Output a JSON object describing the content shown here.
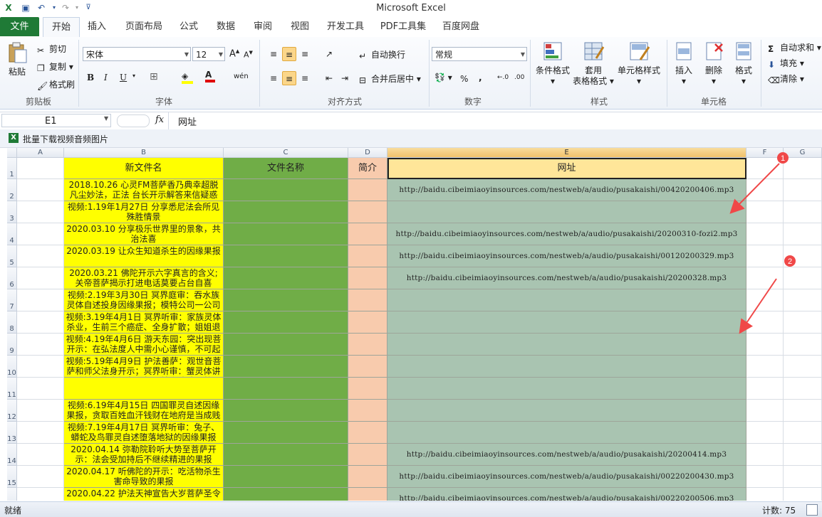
{
  "app": {
    "title": "Microsoft Excel"
  },
  "tabs": [
    "文件",
    "开始",
    "插入",
    "页面布局",
    "公式",
    "数据",
    "审阅",
    "视图",
    "开发工具",
    "PDF工具集",
    "百度网盘"
  ],
  "ribbon": {
    "clipboard": {
      "label": "剪贴板",
      "paste": "粘贴",
      "cut": "剪切",
      "copy": "复制",
      "format_painter": "格式刷"
    },
    "font": {
      "label": "字体",
      "name": "宋体",
      "size": "12",
      "bold": "B",
      "italic": "I",
      "underline": "U",
      "phonetic": "wén"
    },
    "alignment": {
      "label": "对齐方式",
      "wrap": "自动换行",
      "merge": "合并后居中"
    },
    "number": {
      "label": "数字",
      "format": "常规",
      "percent": "%",
      "comma": ",",
      "inc": "+.0 .00",
      "dec": ".00 →.0"
    },
    "styles": {
      "label": "样式",
      "conditional": "条件格式",
      "table_line1": "套用",
      "table_line2": "表格格式",
      "cell_styles": "单元格样式"
    },
    "cells": {
      "label": "单元格",
      "insert": "插入",
      "delete": "删除",
      "format": "格式"
    },
    "editing": {
      "autosum": "自动求和",
      "fill": "填充",
      "clear": "清除"
    }
  },
  "formula_bar": {
    "cell_ref": "E1",
    "fx": "fx",
    "content": "网址"
  },
  "addin": {
    "label": "批量下载视频音频图片"
  },
  "grid": {
    "columns": [
      "A",
      "B",
      "C",
      "D",
      "E",
      "F",
      "G"
    ],
    "headers": {
      "B": "新文件名",
      "C": "文件名称",
      "D": "简介",
      "E": "网址"
    },
    "rows": [
      {
        "n": "2",
        "b": "2018.10.26 心灵FM菩萨香乃典幸超脱凡尘妙法，正法 台长开示解答来信疑惑（一）",
        "e": "http://baidu.cibeimiaoyinsources.com/nestweb/a/audio/pusakaishi/00420200406.mp3"
      },
      {
        "n": "3",
        "b": "视频:1.19年1月27日 分享悉尼法会所见殊胜情景",
        "e": ""
      },
      {
        "n": "4",
        "b": "2020.03.10 分享极乐世界里的景象，共治法喜",
        "e": "http://baidu.cibeimiaoyinsources.com/nestweb/a/audio/pusakaishi/20200310-fozi2.mp3"
      },
      {
        "n": "5",
        "b": "2020.03.19 让众生知道杀生的因缘果报",
        "e": "http://baidu.cibeimiaoyinsources.com/nestweb/a/audio/pusakaishi/00120200329.mp3"
      },
      {
        "n": "6",
        "b": "2020.03.21 佛陀开示六字真言的含义;关帝菩萨揭示打进电话莫要占台自喜",
        "e": "http://baidu.cibeimiaoyinsources.com/nestweb/a/audio/pusakaishi/20200328.mp3"
      },
      {
        "n": "7",
        "b": "视频:2.19年3月30日 冥界庭审：吞水族灵体自述投身因缘果报；模特公司一公司老板",
        "e": ""
      },
      {
        "n": "8",
        "b": "视频:3.19年4月1日 冥界听审：家族灵体杀业，生前三个癌症、全身扩散；姐姐退",
        "e": ""
      },
      {
        "n": "9",
        "b": "视频:4.19年4月6日 游天东园：突出现菩开示：在弘法度人中需小心谨慎，不可起",
        "e": ""
      },
      {
        "n": "10",
        "b": "视频:5.19年4月9日 护法善萨：观世音菩萨和师父法身开示；冥界听审：蟹灵体讲述前世伤害鳄鱼，赶上就会改造一劫",
        "e": ""
      },
      {
        "n": "11",
        "b": "",
        "e": ""
      },
      {
        "n": "12",
        "b": "视频:6.19年4月15日 四国罪灵自述因缘果报，贪取百姓血汗钱财在地府是当成贱财界等，死后会下地狱受酷刑，只好更",
        "e": ""
      },
      {
        "n": "13",
        "b": "视频:7.19年4月17日 冥界听审：兔子、蟒蛇及鸟罪灵自述堕落地狱的因缘果报",
        "e": ""
      },
      {
        "n": "14",
        "b": "2020.04.14 弥勒院聆听大势至菩萨开示：法会受加持后不继续精进的果报",
        "e": "http://baidu.cibeimiaoyinsources.com/nestweb/a/audio/pusakaishi/20200414.mp3"
      },
      {
        "n": "15",
        "b": "2020.04.17 听佛陀的开示：吃活物杀生害命导致的果报",
        "e": "http://baidu.cibeimiaoyinsources.com/nestweb/a/audio/pusakaishi/00220200430.mp3"
      },
      {
        "n": "16",
        "b": "2020.04.22 护法天神宣告大岁菩萨圣令",
        "e": "http://baidu.cibeimiaoyinsources.com/nestweb/a/audio/pusakaishi/00220200506.mp3"
      }
    ]
  },
  "annotations": [
    "1",
    "2"
  ],
  "status": {
    "ready": "就绪",
    "count": "计数: 75"
  },
  "colors": {
    "yellow": "#ffff00",
    "green": "#70ad47",
    "peach": "#f8cbad",
    "greygreen": "#a9c4b1",
    "header_url": "#ffe699",
    "file_tab": "#1f7a36",
    "arrow": "#f04848"
  }
}
